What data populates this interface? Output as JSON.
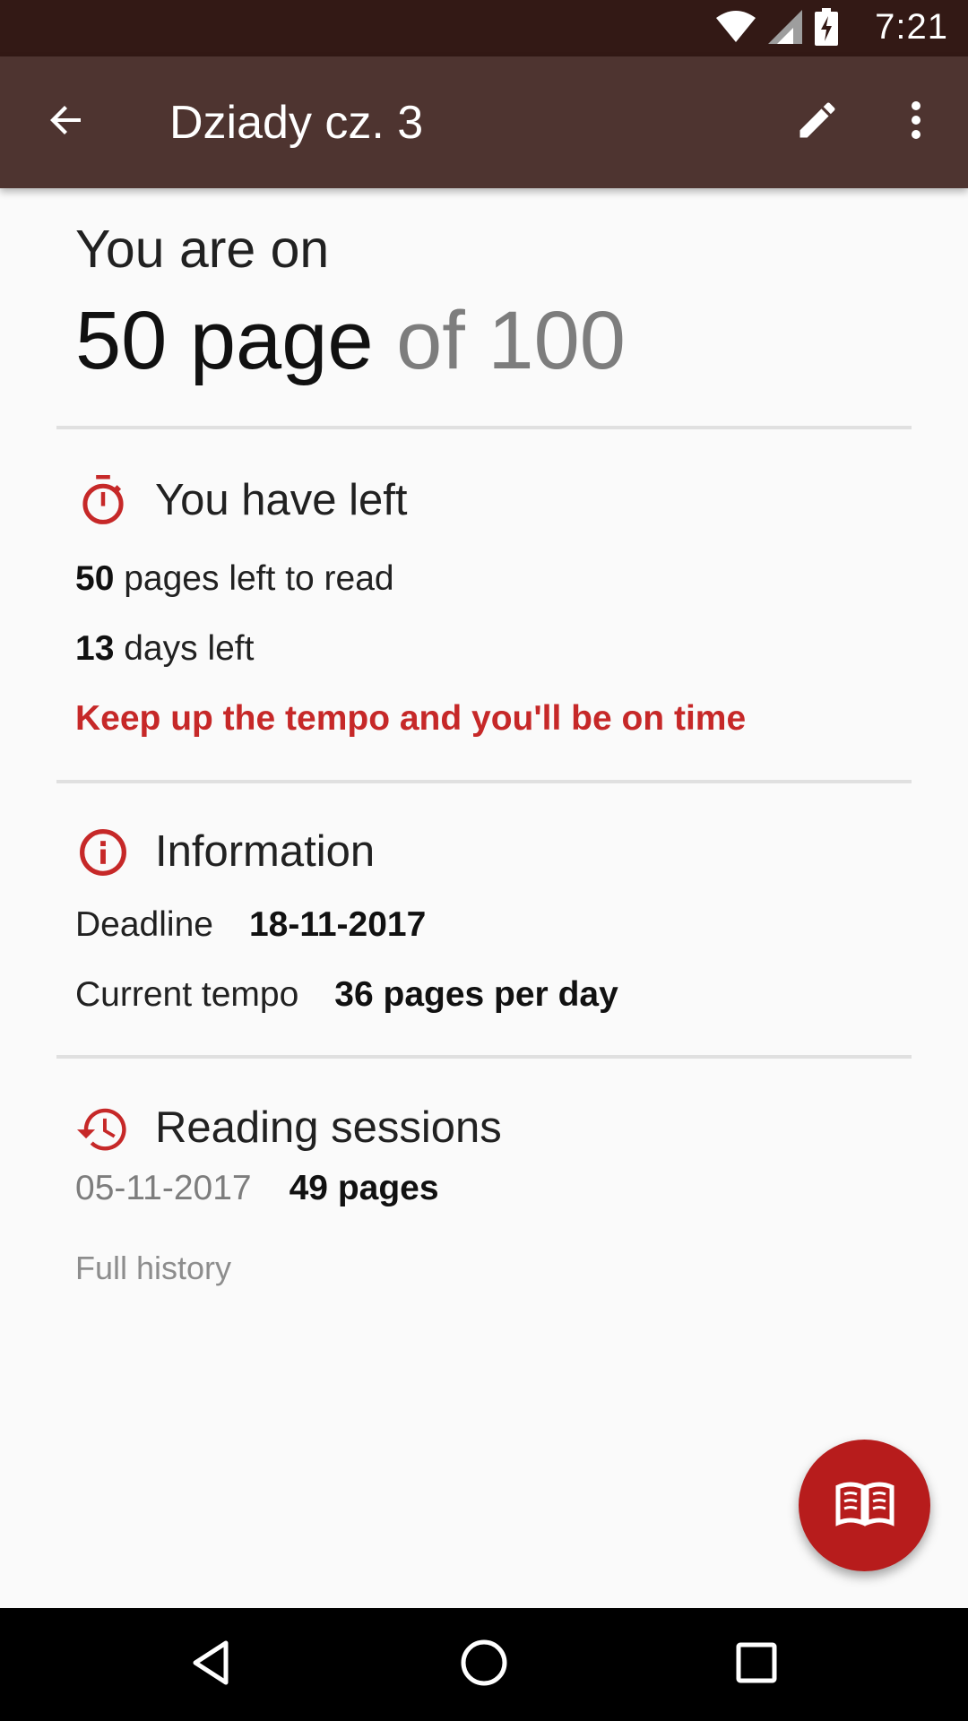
{
  "status_bar": {
    "time": "7:21",
    "icons": [
      "wifi-icon",
      "signal-icon",
      "battery-charging-icon"
    ]
  },
  "app_bar": {
    "title": "Dziady cz. 3",
    "icons": [
      "back-arrow-icon",
      "edit-pencil-icon",
      "more-vert-icon"
    ]
  },
  "progress": {
    "label": "You are on",
    "current_page": "50 page",
    "of_total": "of 100"
  },
  "left_section": {
    "title": "You have left",
    "icon": "timer-icon",
    "pages_left_value": "50",
    "pages_left_label": "pages left to read",
    "days_left_value": "13",
    "days_left_label": "days left",
    "message": "Keep up the tempo and you'll be on time"
  },
  "info_section": {
    "title": "Information",
    "icon": "info-icon",
    "deadline_label": "Deadline",
    "deadline_value": "18-11-2017",
    "tempo_label": "Current tempo",
    "tempo_value": "36 pages per day"
  },
  "sessions_section": {
    "title": "Reading sessions",
    "icon": "history-icon",
    "sessions": [
      {
        "date": "05-11-2017",
        "pages": "49 pages"
      }
    ],
    "full_history_label": "Full history"
  },
  "fab": {
    "icon": "open-book-icon"
  },
  "nav_bar": {
    "icons": [
      "back-triangle-icon",
      "home-circle-icon",
      "recents-square-icon"
    ]
  },
  "colors": {
    "status_bar": "#331915",
    "app_bar": "#4e3430",
    "accent": "#c62828",
    "fab": "#b71c1c"
  }
}
